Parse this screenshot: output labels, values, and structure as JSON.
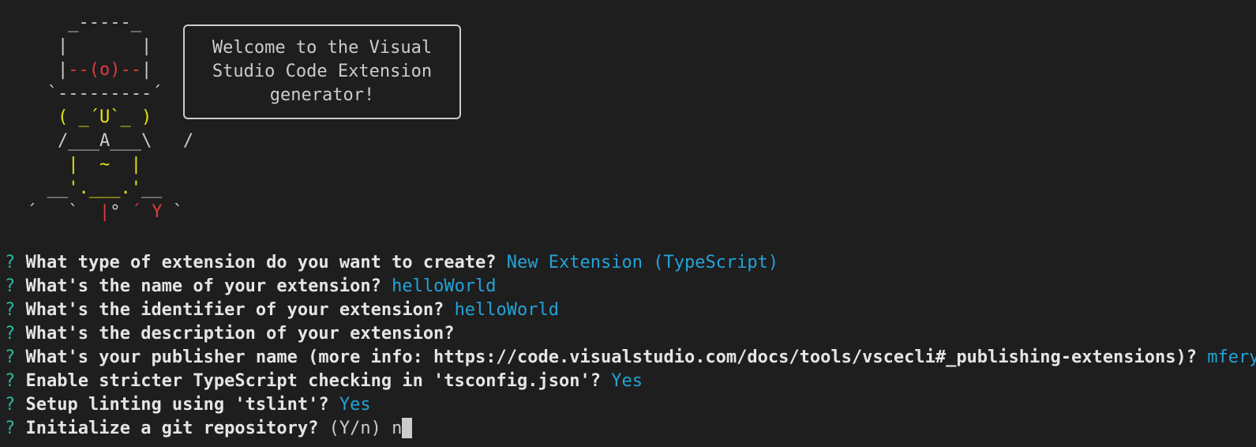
{
  "ascii_art": {
    "lines": [
      [
        {
          "t": "     _-----_",
          "c": "#cccccc"
        }
      ],
      [
        {
          "t": "    |       |",
          "c": "#cccccc"
        }
      ],
      [
        {
          "t": "    |",
          "c": "#cccccc"
        },
        {
          "t": "--(o)--",
          "c": "#e0393e"
        },
        {
          "t": "|",
          "c": "#cccccc"
        }
      ],
      [
        {
          "t": "   `---------´",
          "c": "#cccccc"
        }
      ],
      [
        {
          "t": "    ( _´U`_ )",
          "c": "#e5e510"
        }
      ],
      [
        {
          "t": "    /___A___\\",
          "c": "#cccccc"
        },
        {
          "t": "   /",
          "c": "#cccccc"
        }
      ],
      [
        {
          "t": "     |  ~  |",
          "c": "#e5e510"
        }
      ],
      [
        {
          "t": "   __",
          "c": "#cccccc"
        },
        {
          "t": "'.___.'",
          "c": "#e5e510"
        },
        {
          "t": "__",
          "c": "#cccccc"
        }
      ],
      [
        {
          "t": " ´   `  ",
          "c": "#cccccc"
        },
        {
          "t": "|",
          "c": "#e0393e"
        },
        {
          "t": "° ",
          "c": "#cccccc"
        },
        {
          "t": "´ Y",
          "c": "#e0393e"
        },
        {
          "t": " `",
          "c": "#cccccc"
        }
      ]
    ]
  },
  "welcome": {
    "text": "Welcome to the Visual\nStudio Code Extension\ngenerator!"
  },
  "prompts": [
    {
      "question": "What type of extension do you want to create?",
      "answer": "New Extension (TypeScript)"
    },
    {
      "question": "What's the name of your extension?",
      "answer": "helloWorld"
    },
    {
      "question": "What's the identifier of your extension?",
      "answer": "helloWorld"
    },
    {
      "question": "What's the description of your extension?",
      "answer": ""
    },
    {
      "question": "What's your publisher name (more info: https://code.visualstudio.com/docs/tools/vscecli#_publishing-extensions)?",
      "answer": "mfery"
    },
    {
      "question": "Enable stricter TypeScript checking in 'tsconfig.json'?",
      "answer": "Yes"
    },
    {
      "question": "Setup linting using 'tslint'?",
      "answer": "Yes"
    }
  ],
  "current_prompt": {
    "question": "Initialize a git repository?",
    "hint": "(Y/n)",
    "typed": "n"
  },
  "prompt_symbol": "?",
  "colors": {
    "background": "#1e1e1e",
    "foreground": "#cccccc",
    "prompt_symbol": "#2fb8a0",
    "answer": "#23a3d8",
    "art_red": "#e0393e",
    "art_yellow": "#e5e510"
  }
}
